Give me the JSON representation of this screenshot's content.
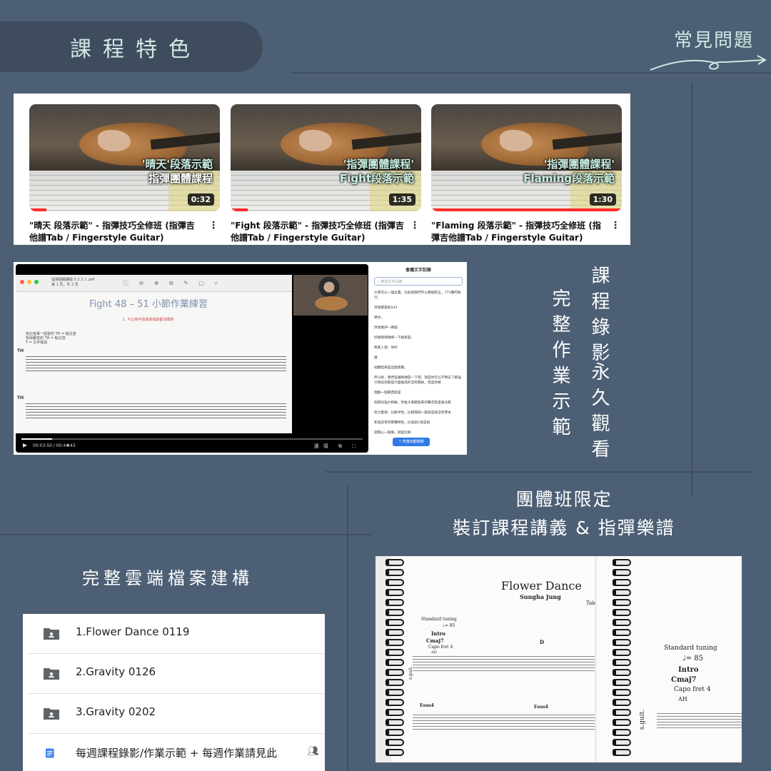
{
  "header": {
    "section_title": "課程特色",
    "faq_label": "常見問題"
  },
  "videos": [
    {
      "caption_top": "'晴天'段落示範",
      "caption_bottom": "指彈團體課程",
      "duration": "0:32",
      "progress": 0.09,
      "title": "\"晴天 段落示範\" - 指彈技巧全修班 (指彈吉他譜Tab / Fingerstyle Guitar)"
    },
    {
      "caption_top": "'指彈團體課程'",
      "caption_bottom": "Fight段落示範",
      "duration": "1:35",
      "progress": 0.09,
      "title": "\"Fight 段落示範\" - 指彈技巧全修班 (指彈吉他譜Tab / Fingerstyle Guitar)"
    },
    {
      "caption_top": "'指彈團體課程'",
      "caption_bottom": "Flaming段落示範",
      "duration": "1:30",
      "progress": 1.0,
      "title": "\"Flaming 段落示範\" - 指彈技巧全修班 (指彈吉他譜Tab / Fingerstyle Guitar)"
    }
  ],
  "player": {
    "pdf_filename": "指彈團體課程 0 2 2 2 .pdf",
    "pdf_subtitle": "第 1 頁，共 2 頁",
    "pdf_heading": "Fight 48 – 51 小節作業練習",
    "pdf_red_note": "1. 可以用中指或食指敲都沒關係",
    "pdf_note_lines": [
      "如只有單一個音的 TH = 點泛音",
      "有兩顆音的 TH = 點泛音",
      "T = 左手點弦"
    ],
    "tab_label": "T A B",
    "tab_text_th": "TH",
    "time": "00:03:50 / 00:44:43",
    "progress": 0.09,
    "controls_right": "選項"
  },
  "transcript": {
    "title": "會議文字記錄",
    "search_placeholder": "搜尋文字記錄",
    "lines": [
      "大家可以一個位置，比如說我們平以兩個到五，771種的執行，",
      "然後都是則543",
      "晃你，",
      "然後再評一兩個",
      "好給我稍微刷一下給家庭，",
      "我家人想，你好",
      "誰",
      "他聽起來是這個感覺，",
      "所以呢，我們這邊稍微提一下吧，就是你可以不用去了解強力和弦到底是什麼組成的沒有關係，但是你要",
      "理解一個東西就是",
      "他就叫強力和線，然後大家聽起來的聲音就是會比較",
      "有力量感，比較中性，比較陽剛一點就是他沒有原本",
      "和弦該有的那種特色，比如說C就是很",
      "就開心一點嘛，就是比較"
    ],
    "resume_button": "恢復自動捲動"
  },
  "features": {
    "recording_col1": "課程錄影",
    "recording_col2": "永久觀看",
    "homework_col": "完整作業示範",
    "group_line1": "團體班限定",
    "group_line2": "裝訂課程講義 & 指彈樂譜",
    "cloud_title": "完整雲端檔案建構"
  },
  "drive_files": [
    {
      "name": "1.Flower Dance 0119",
      "icon": "shared-folder-icon"
    },
    {
      "name": "2.Gravity 0126",
      "icon": "shared-folder-icon"
    },
    {
      "name": "3.Gravity 0202",
      "icon": "shared-folder-icon"
    },
    {
      "name": "每週課程錄影/作業示範 + 每週作業請見此",
      "icon": "doc-icon",
      "shared": "people-icon"
    }
  ],
  "score": {
    "title": "Flower Dance",
    "composer": "Sungha Jung",
    "tab_corner": "Tab",
    "tuning": "Standard tuning",
    "tempo": "♩= 85",
    "section": "Intro",
    "chord1": "Cmaj7",
    "capo": "Capo fret 4",
    "ah": "AH",
    "chord_d": "D",
    "chord_esus": "Esus4",
    "instrument": "s.guit.",
    "right_tuning": "Standard tuning",
    "right_tempo": "♩= 85",
    "right_section": "Intro",
    "right_chord": "Cmaj7",
    "right_capo": "Capo fret 4",
    "right_ah": "AH"
  },
  "colors": {
    "background": "#4d5f75",
    "pill": "#3e4c5e",
    "mint": "#cfe8e2",
    "yt_red": "#ff2b2b",
    "accent_blue": "#2f7ae5"
  }
}
